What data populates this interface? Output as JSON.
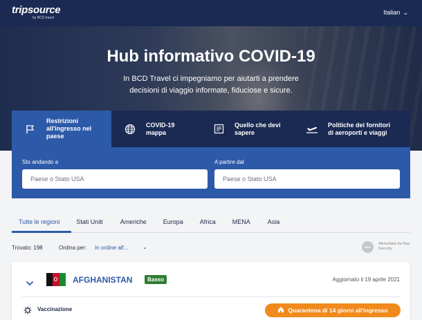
{
  "header": {
    "logo_text": "tripsource",
    "logo_sub": "by BCD travel",
    "language": "Italian"
  },
  "hero": {
    "title": "Hub informativo COVID-19",
    "subtitle": "In BCD Travel ci impegniamo per aiutarti a prendere decisioni di viaggio informate, fiduciose e sicure."
  },
  "tabs": [
    {
      "label": "Restrizioni all'ingresso nel paese",
      "icon": "flag-icon",
      "active": true
    },
    {
      "label": "COVID-19 mappa",
      "icon": "globe-icon",
      "active": false
    },
    {
      "label": "Quello che devi sapere",
      "icon": "document-icon",
      "active": false
    },
    {
      "label": "Politiche dei fornitori di aeroporti e viaggi",
      "icon": "plane-icon",
      "active": false
    }
  ],
  "search": {
    "dest_label": "Sto andando a",
    "dest_placeholder": "Paese o Stato USA",
    "origin_label": "A partire dal",
    "origin_placeholder": "Paese o Stato USA"
  },
  "regions": [
    "Tutte le regioni",
    "Stati Uniti",
    "Americhe",
    "Europa",
    "Africa",
    "MENA",
    "Asia"
  ],
  "results": {
    "found_label": "Trovato:",
    "found_count": "198",
    "sort_label": "Ordina per:",
    "sort_value": "In ordine alf..."
  },
  "powered_by": {
    "logo_text": "MAX",
    "text": "Alimentato da Max Security"
  },
  "country_card": {
    "name": "AFGHANISTAN",
    "risk_badge": "Basso",
    "updated": "Aggiornato  il 19 aprile 2021",
    "vaccination_label": "Vaccinazione",
    "quarantine_label": "Quarantena di 14 giorni all'ingresso"
  },
  "colors": {
    "navy": "#1b2a52",
    "accent_blue": "#2d5aa8",
    "badge_green": "#2e7d32",
    "quarantine_orange": "#f08a1c"
  }
}
